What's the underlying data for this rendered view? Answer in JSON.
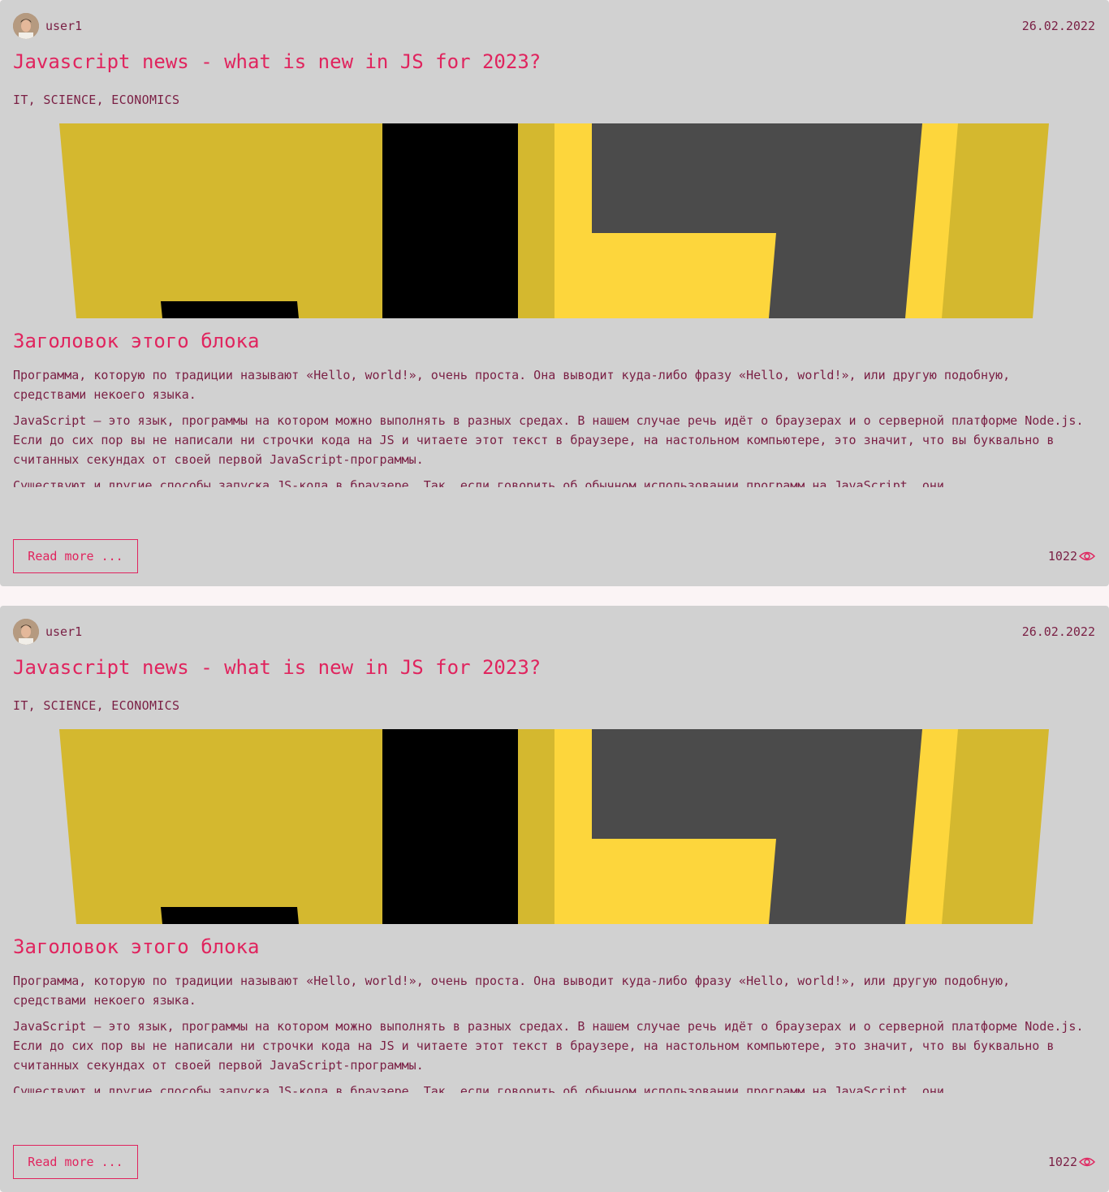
{
  "posts": [
    {
      "author": "user1",
      "date": "26.02.2022",
      "title": "Javascript news - what is new in JS for 2023?",
      "tags": "IT, SCIENCE, ECONOMICS",
      "block_title": "Заголовок этого блока",
      "paragraphs": [
        "Программа, которую по традиции называют «Hello, world!», очень проста. Она выводит куда-либо фразу «Hello, world!», или другую подобную, средствами некоего языка.",
        "JavaScript — это язык, программы на котором можно выполнять в разных средах. В нашем случае речь идёт о браузерах и о серверной платформе Node.js. Если до сих пор вы не написали ни строчки кода на JS и читаете этот текст в браузере, на настольном компьютере, это значит, что вы буквально в считанных секундах от своей первой JavaScript-программы.",
        "Существуют и другие способы запуска JS-кода в браузере. Так, если говорить об обычном использовании программ на JavaScript, они"
      ],
      "read_more_label": "Read more ...",
      "views": "1022"
    },
    {
      "author": "user1",
      "date": "26.02.2022",
      "title": "Javascript news - what is new in JS for 2023?",
      "tags": "IT, SCIENCE, ECONOMICS",
      "block_title": "Заголовок этого блока",
      "paragraphs": [
        "Программа, которую по традиции называют «Hello, world!», очень проста. Она выводит куда-либо фразу «Hello, world!», или другую подобную, средствами некоего языка.",
        "JavaScript — это язык, программы на котором можно выполнять в разных средах. В нашем случае речь идёт о браузерах и о серверной платформе Node.js. Если до сих пор вы не написали ни строчки кода на JS и читаете этот текст в браузере, на настольном компьютере, это значит, что вы буквально в считанных секундах от своей первой JavaScript-программы.",
        "Существуют и другие способы запуска JS-кода в браузере. Так, если говорить об обычном использовании программ на JavaScript, они"
      ],
      "read_more_label": "Read more ...",
      "views": "1022"
    }
  ],
  "icons": {
    "avatar": "avatar-photo",
    "views": "eye-icon"
  },
  "colors": {
    "accent": "#e0245e",
    "text": "#7a1f44",
    "card": "#d1d1d1",
    "page": "#fbf4f5"
  }
}
